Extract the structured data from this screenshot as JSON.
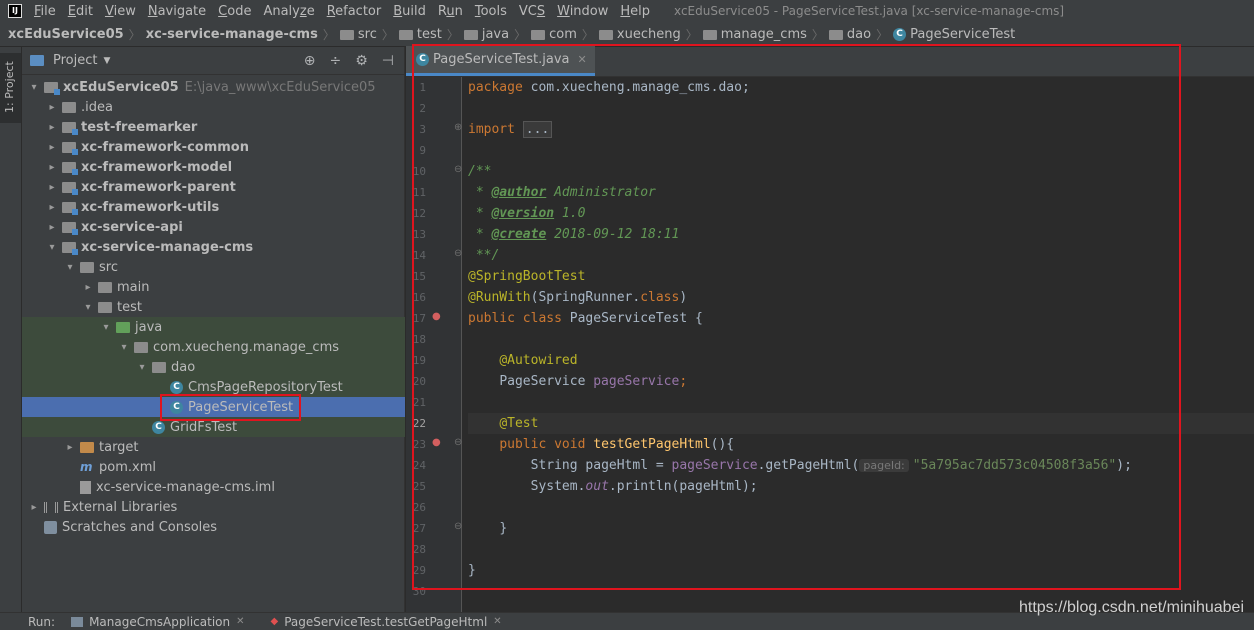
{
  "menubar": {
    "logo": "IJ",
    "items": [
      {
        "label": "File",
        "key": "F"
      },
      {
        "label": "Edit",
        "key": "E"
      },
      {
        "label": "View",
        "key": "V"
      },
      {
        "label": "Navigate",
        "key": "N"
      },
      {
        "label": "Code",
        "key": "C"
      },
      {
        "label": "Analyze",
        "key": "z"
      },
      {
        "label": "Refactor",
        "key": "R"
      },
      {
        "label": "Build",
        "key": "B"
      },
      {
        "label": "Run",
        "key": "u"
      },
      {
        "label": "Tools",
        "key": "T"
      },
      {
        "label": "VCS",
        "key": "S"
      },
      {
        "label": "Window",
        "key": "W"
      },
      {
        "label": "Help",
        "key": "H"
      }
    ],
    "window_title": "xcEduService05 - PageServiceTest.java [xc-service-manage-cms]"
  },
  "breadcrumb": [
    "xcEduService05",
    "xc-service-manage-cms",
    "src",
    "test",
    "java",
    "com",
    "xuecheng",
    "manage_cms",
    "dao",
    "PageServiceTest"
  ],
  "toolstrip": {
    "project_tab": "1: Project"
  },
  "project_panel": {
    "title": "Project",
    "tools": {
      "locate": "⊕",
      "collapse": "÷",
      "settings": "⚙",
      "hide": "⊣"
    },
    "tree": [
      {
        "label": "xcEduService05",
        "extra": "E:\\java_www\\xcEduService05",
        "depth": 0,
        "arrow": "▾",
        "icon": "module",
        "bold": true
      },
      {
        "label": ".idea",
        "depth": 1,
        "arrow": "▸",
        "icon": "folder"
      },
      {
        "label": "test-freemarker",
        "depth": 1,
        "arrow": "▸",
        "icon": "module",
        "bold": true
      },
      {
        "label": "xc-framework-common",
        "depth": 1,
        "arrow": "▸",
        "icon": "module",
        "bold": true
      },
      {
        "label": "xc-framework-model",
        "depth": 1,
        "arrow": "▸",
        "icon": "module",
        "bold": true
      },
      {
        "label": "xc-framework-parent",
        "depth": 1,
        "arrow": "▸",
        "icon": "module",
        "bold": true
      },
      {
        "label": "xc-framework-utils",
        "depth": 1,
        "arrow": "▸",
        "icon": "module",
        "bold": true
      },
      {
        "label": "xc-service-api",
        "depth": 1,
        "arrow": "▸",
        "icon": "module",
        "bold": true
      },
      {
        "label": "xc-service-manage-cms",
        "depth": 1,
        "arrow": "▾",
        "icon": "module",
        "bold": true
      },
      {
        "label": "src",
        "depth": 2,
        "arrow": "▾",
        "icon": "folder"
      },
      {
        "label": "main",
        "depth": 3,
        "arrow": "▸",
        "icon": "folder"
      },
      {
        "label": "test",
        "depth": 3,
        "arrow": "▾",
        "icon": "folder"
      },
      {
        "label": "java",
        "depth": 4,
        "arrow": "▾",
        "icon": "folder-green",
        "hl": true
      },
      {
        "label": "com.xuecheng.manage_cms",
        "depth": 5,
        "arrow": "▾",
        "icon": "folder",
        "hl": true
      },
      {
        "label": "dao",
        "depth": 6,
        "arrow": "▾",
        "icon": "folder",
        "hl": true
      },
      {
        "label": "CmsPageRepositoryTest",
        "depth": 7,
        "arrow": "",
        "icon": "class",
        "hl": true
      },
      {
        "label": "PageServiceTest",
        "depth": 7,
        "arrow": "",
        "icon": "class",
        "sel": true
      },
      {
        "label": "GridFsTest",
        "depth": 6,
        "arrow": "",
        "icon": "class",
        "hl": true
      },
      {
        "label": "target",
        "depth": 2,
        "arrow": "▸",
        "icon": "folder-orange"
      },
      {
        "label": "pom.xml",
        "depth": 2,
        "arrow": "",
        "icon": "maven"
      },
      {
        "label": "xc-service-manage-cms.iml",
        "depth": 2,
        "arrow": "",
        "icon": "file"
      },
      {
        "label": "External Libraries",
        "depth": 0,
        "arrow": "▸",
        "icon": "lib"
      },
      {
        "label": "Scratches and Consoles",
        "depth": 0,
        "arrow": "",
        "icon": "scratch"
      }
    ]
  },
  "editor": {
    "tab_label": "PageServiceTest.java",
    "current_line": 22,
    "line_numbers": [
      "1",
      "2",
      "3",
      "9",
      "10",
      "11",
      "12",
      "13",
      "14",
      "15",
      "16",
      "17",
      "18",
      "19",
      "20",
      "21",
      "22",
      "23",
      "24",
      "25",
      "26",
      "27",
      "28",
      "29",
      "30"
    ],
    "code": {
      "l1_kw": "package",
      "l1_rest": " com.xuecheng.manage_cms.dao;",
      "l3_kw": "import",
      "l3_fold": "...",
      "l10": "/**",
      "l11_pre": " * ",
      "l11_tag": "@author",
      "l11_val": " Administrator",
      "l12_pre": " * ",
      "l12_tag": "@version",
      "l12_val": " 1.0",
      "l13_pre": " * ",
      "l13_tag": "@create",
      "l13_val": " 2018-09-12 18:11",
      "l14": " **/",
      "l15": "@SpringBootTest",
      "l16_ann": "@RunWith",
      "l16_a": "(SpringRunner.",
      "l16_kw": "class",
      "l16_b": ")",
      "l17_kw1": "public",
      "l17_kw2": " class",
      "l17_rest": " PageServiceTest {",
      "l19": "@Autowired",
      "l20_type": "PageService ",
      "l20_field": "pageService",
      "l20_end": ";",
      "l22": "@Test",
      "l23_kw1": "public",
      "l23_kw2": " void",
      "l23_fn": " testGetPageHtml",
      "l23_end": "(){",
      "l24_a": "String pageHtml = ",
      "l24_field": "pageService",
      "l24_b": ".getPageHtml(",
      "l24_hint": "pageId:",
      "l24_str": "\"5a795ac7dd573c04508f3a56\"",
      "l24_end": ");",
      "l25_a": "System.",
      "l25_field": "out",
      "l25_b": ".println(pageHtml);",
      "l27": "}",
      "l29": "}"
    }
  },
  "runbar": {
    "label": "Run:",
    "tabs": [
      "ManageCmsApplication",
      "PageServiceTest.testGetPageHtml"
    ]
  },
  "watermark": "https://blog.csdn.net/minihuabei",
  "colors": {
    "highlight_box": "#e0141e",
    "selection": "#4b6eaf",
    "test_scope_bg": "#3d4b3c"
  }
}
